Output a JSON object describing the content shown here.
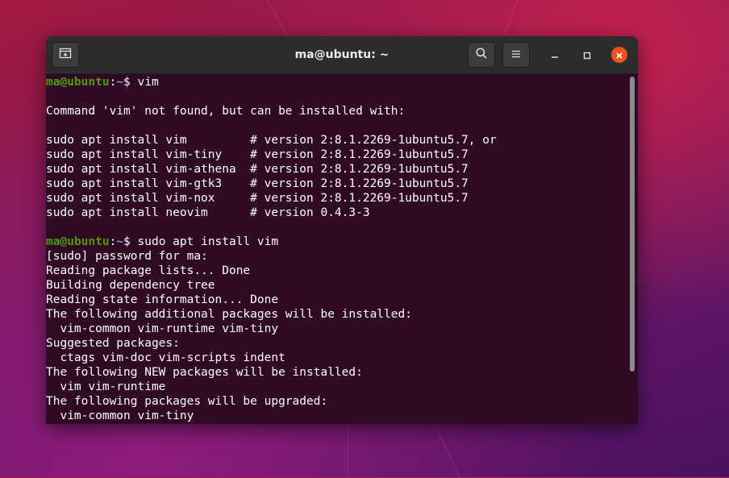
{
  "window": {
    "title": "ma@ubuntu: ~"
  },
  "terminal": {
    "lines": [
      {
        "prompt_user": "ma@ubuntu",
        "prompt_sep": ":",
        "prompt_path": "~",
        "prompt_end": "$ ",
        "text": "vim"
      },
      {
        "text": ""
      },
      {
        "text": "Command 'vim' not found, but can be installed with:"
      },
      {
        "text": ""
      },
      {
        "text": "sudo apt install vim         # version 2:8.1.2269-1ubuntu5.7, or"
      },
      {
        "text": "sudo apt install vim-tiny    # version 2:8.1.2269-1ubuntu5.7"
      },
      {
        "text": "sudo apt install vim-athena  # version 2:8.1.2269-1ubuntu5.7"
      },
      {
        "text": "sudo apt install vim-gtk3    # version 2:8.1.2269-1ubuntu5.7"
      },
      {
        "text": "sudo apt install vim-nox     # version 2:8.1.2269-1ubuntu5.7"
      },
      {
        "text": "sudo apt install neovim      # version 0.4.3-3"
      },
      {
        "text": ""
      },
      {
        "prompt_user": "ma@ubuntu",
        "prompt_sep": ":",
        "prompt_path": "~",
        "prompt_end": "$ ",
        "text": "sudo apt install vim"
      },
      {
        "text": "[sudo] password for ma:"
      },
      {
        "text": "Reading package lists... Done"
      },
      {
        "text": "Building dependency tree"
      },
      {
        "text": "Reading state information... Done"
      },
      {
        "text": "The following additional packages will be installed:"
      },
      {
        "text": "  vim-common vim-runtime vim-tiny"
      },
      {
        "text": "Suggested packages:"
      },
      {
        "text": "  ctags vim-doc vim-scripts indent"
      },
      {
        "text": "The following NEW packages will be installed:"
      },
      {
        "text": "  vim vim-runtime"
      },
      {
        "text": "The following packages will be upgraded:"
      },
      {
        "text": "  vim-common vim-tiny"
      }
    ]
  },
  "colors": {
    "terminal_bg": "#300a24",
    "prompt_user": "#4e9a06",
    "prompt_path": "#729fcf",
    "close_button": "#e95420"
  },
  "icons": {
    "new_tab": "new-tab-icon",
    "search": "search-icon",
    "menu": "hamburger-menu-icon",
    "minimize": "minimize-icon",
    "maximize": "maximize-icon",
    "close": "close-icon"
  }
}
